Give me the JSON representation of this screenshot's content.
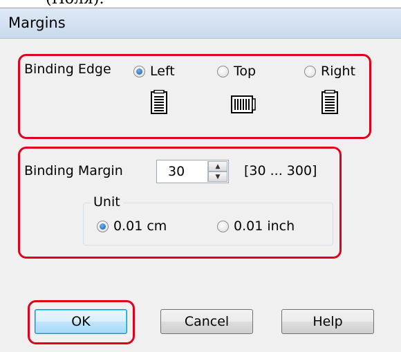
{
  "top_fragment": "(Поля).",
  "window": {
    "title": "Margins"
  },
  "binding_edge": {
    "label": "Binding Edge",
    "options": [
      {
        "label": "Left",
        "selected": true,
        "icon": "page-left-binding-icon"
      },
      {
        "label": "Top",
        "selected": false,
        "icon": "page-top-binding-icon"
      },
      {
        "label": "Right",
        "selected": false,
        "icon": "page-right-binding-icon"
      }
    ]
  },
  "binding_margin": {
    "label": "Binding Margin",
    "value": "30",
    "range": "[30 ... 300]",
    "unit": {
      "legend": "Unit",
      "options": [
        {
          "label": "0.01 cm",
          "selected": true
        },
        {
          "label": "0.01 inch",
          "selected": false
        }
      ]
    }
  },
  "buttons": {
    "ok": "OK",
    "cancel": "Cancel",
    "help": "Help"
  },
  "colors": {
    "highlight": "#e0001b",
    "dialog_bg": "#f0f0f0",
    "radio_dot": "#1c58a8"
  }
}
